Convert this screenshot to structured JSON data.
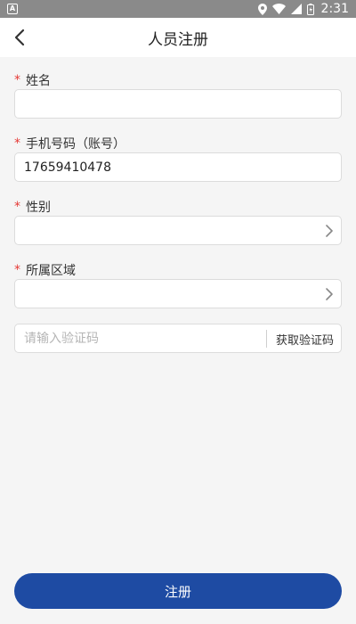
{
  "status_bar": {
    "notification_icon_label": "A",
    "time": "2:31"
  },
  "header": {
    "title": "人员注册"
  },
  "form": {
    "name": {
      "label": "姓名",
      "required": "*",
      "value": "",
      "placeholder": ""
    },
    "phone": {
      "label": "手机号码（账号）",
      "required": "*",
      "value": "17659410478",
      "placeholder": ""
    },
    "gender": {
      "label": "性别",
      "required": "*",
      "value": ""
    },
    "region": {
      "label": "所属区域",
      "required": "*",
      "value": ""
    },
    "code": {
      "placeholder": "请输入验证码",
      "value": "",
      "button_label": "获取验证码"
    }
  },
  "submit": {
    "label": "注册"
  },
  "colors": {
    "primary": "#1e4ba3",
    "required": "#e53935",
    "statusbar": "#8a8a8a"
  }
}
